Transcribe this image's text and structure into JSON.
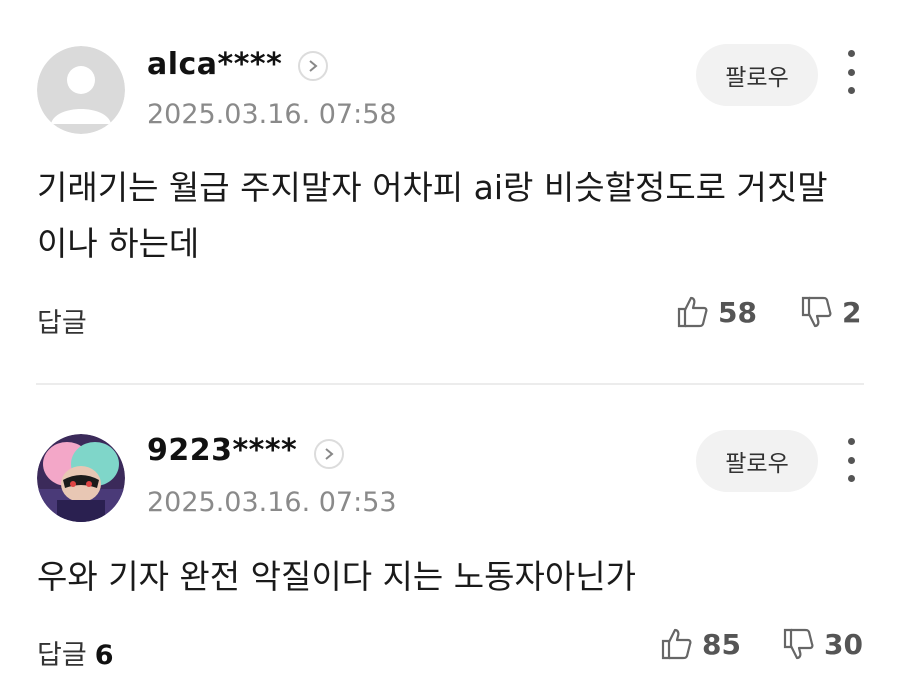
{
  "comments": [
    {
      "username": "alca****",
      "timestamp": "2025.03.16. 07:58",
      "follow_label": "팔로우",
      "text": "기래기는 월급 주지말자 어차피 ai랑 비슷할정도로 거짓말이나 하는데",
      "reply_label": "답글",
      "reply_count": "",
      "likes": "58",
      "dislikes": "2",
      "avatar": "default-user-icon"
    },
    {
      "username": "9223****",
      "timestamp": "2025.03.16. 07:53",
      "follow_label": "팔로우",
      "text": "우와 기자 완전 악질이다 지는 노동자아닌가",
      "reply_label": "답글",
      "reply_count": "6",
      "likes": "85",
      "dislikes": "30",
      "avatar": "character-avatar"
    }
  ],
  "colors": {
    "timestamp": "#8a8a8a",
    "follow_bg": "#f2f2f2",
    "divider": "#ececec"
  }
}
